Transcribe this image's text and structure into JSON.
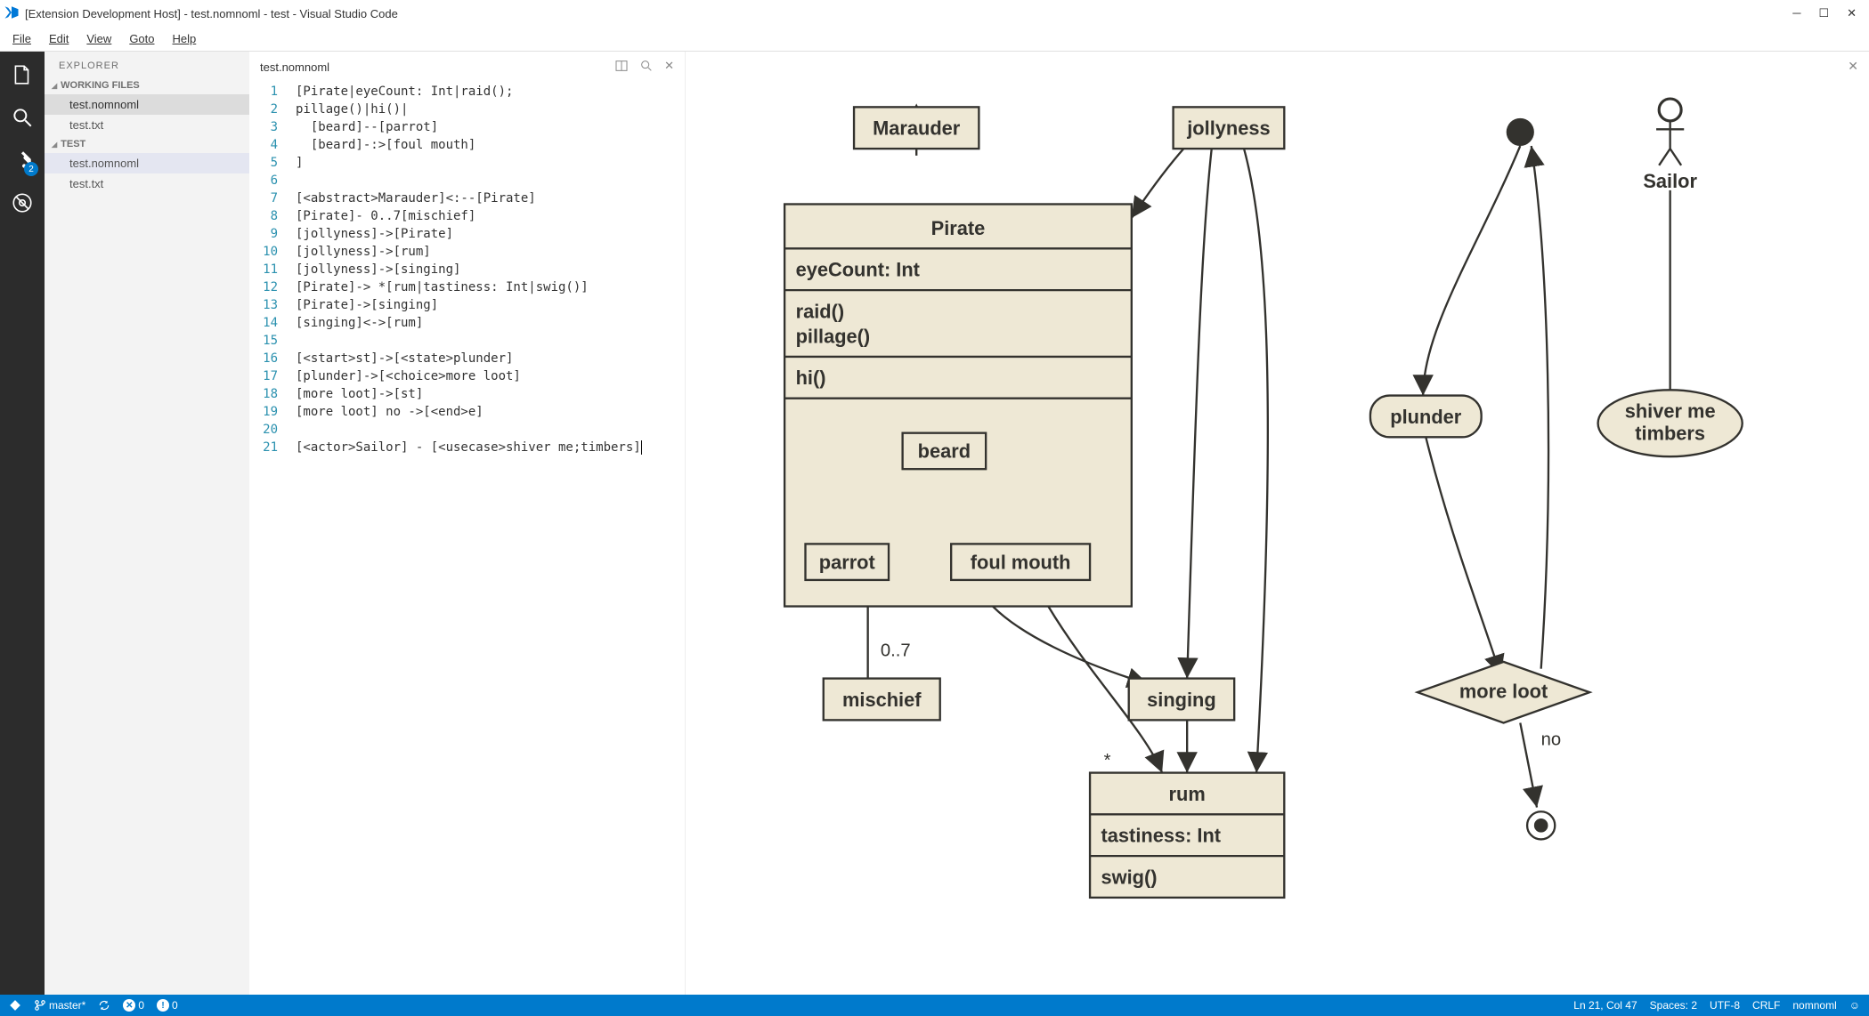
{
  "window": {
    "title": "[Extension Development Host] - test.nomnoml - test - Visual Studio Code"
  },
  "menu": {
    "items": [
      "File",
      "Edit",
      "View",
      "Goto",
      "Help"
    ]
  },
  "activity": {
    "badge": "2"
  },
  "sidebar": {
    "title": "EXPLORER",
    "sections": [
      {
        "title": "WORKING FILES",
        "items": [
          "test.nomnoml",
          "test.txt"
        ],
        "active": 0
      },
      {
        "title": "TEST",
        "items": [
          "test.nomnoml",
          "test.txt"
        ],
        "active": 0
      }
    ]
  },
  "editor": {
    "tab": "test.nomnoml",
    "lines": [
      "[Pirate|eyeCount: Int|raid();",
      "pillage()|hi()|",
      "  [beard]--[parrot]",
      "  [beard]-:>[foul mouth]",
      "]",
      "",
      "[<abstract>Marauder]<:--[Pirate]",
      "[Pirate]- 0..7[mischief]",
      "[jollyness]->[Pirate]",
      "[jollyness]->[rum]",
      "[jollyness]->[singing]",
      "[Pirate]-> *[rum|tastiness: Int|swig()]",
      "[Pirate]->[singing]",
      "[singing]<->[rum]",
      "",
      "[<start>st]->[<state>plunder]",
      "[plunder]->[<choice>more loot]",
      "[more loot]->[st]",
      "[more loot] no ->[<end>e]",
      "",
      "[<actor>Sailor] - [<usecase>shiver me;timbers]"
    ]
  },
  "diagram": {
    "nodes": {
      "marauder": "Marauder",
      "jollyness": "jollyness",
      "sailor": "Sailor",
      "pirate": "Pirate",
      "eyeCount": "eyeCount: Int",
      "raid": "raid()",
      "pillage": "pillage()",
      "hi": "hi()",
      "beard": "beard",
      "parrot": "parrot",
      "foulmouth": "foul mouth",
      "mischief": "mischief",
      "mischief_mult": "0..7",
      "singing": "singing",
      "plunder": "plunder",
      "moreloot": "more loot",
      "no": "no",
      "shiver1": "shiver me",
      "shiver2": "timbers",
      "rum": "rum",
      "tastiness": "tastiness: Int",
      "swig": "swig()",
      "star": "*"
    }
  },
  "status": {
    "branch": "master*",
    "errors": "0",
    "warnings": "0",
    "cursor": "Ln 21, Col 47",
    "spaces": "Spaces: 2",
    "encoding": "UTF-8",
    "eol": "CRLF",
    "mode": "nomnoml"
  }
}
